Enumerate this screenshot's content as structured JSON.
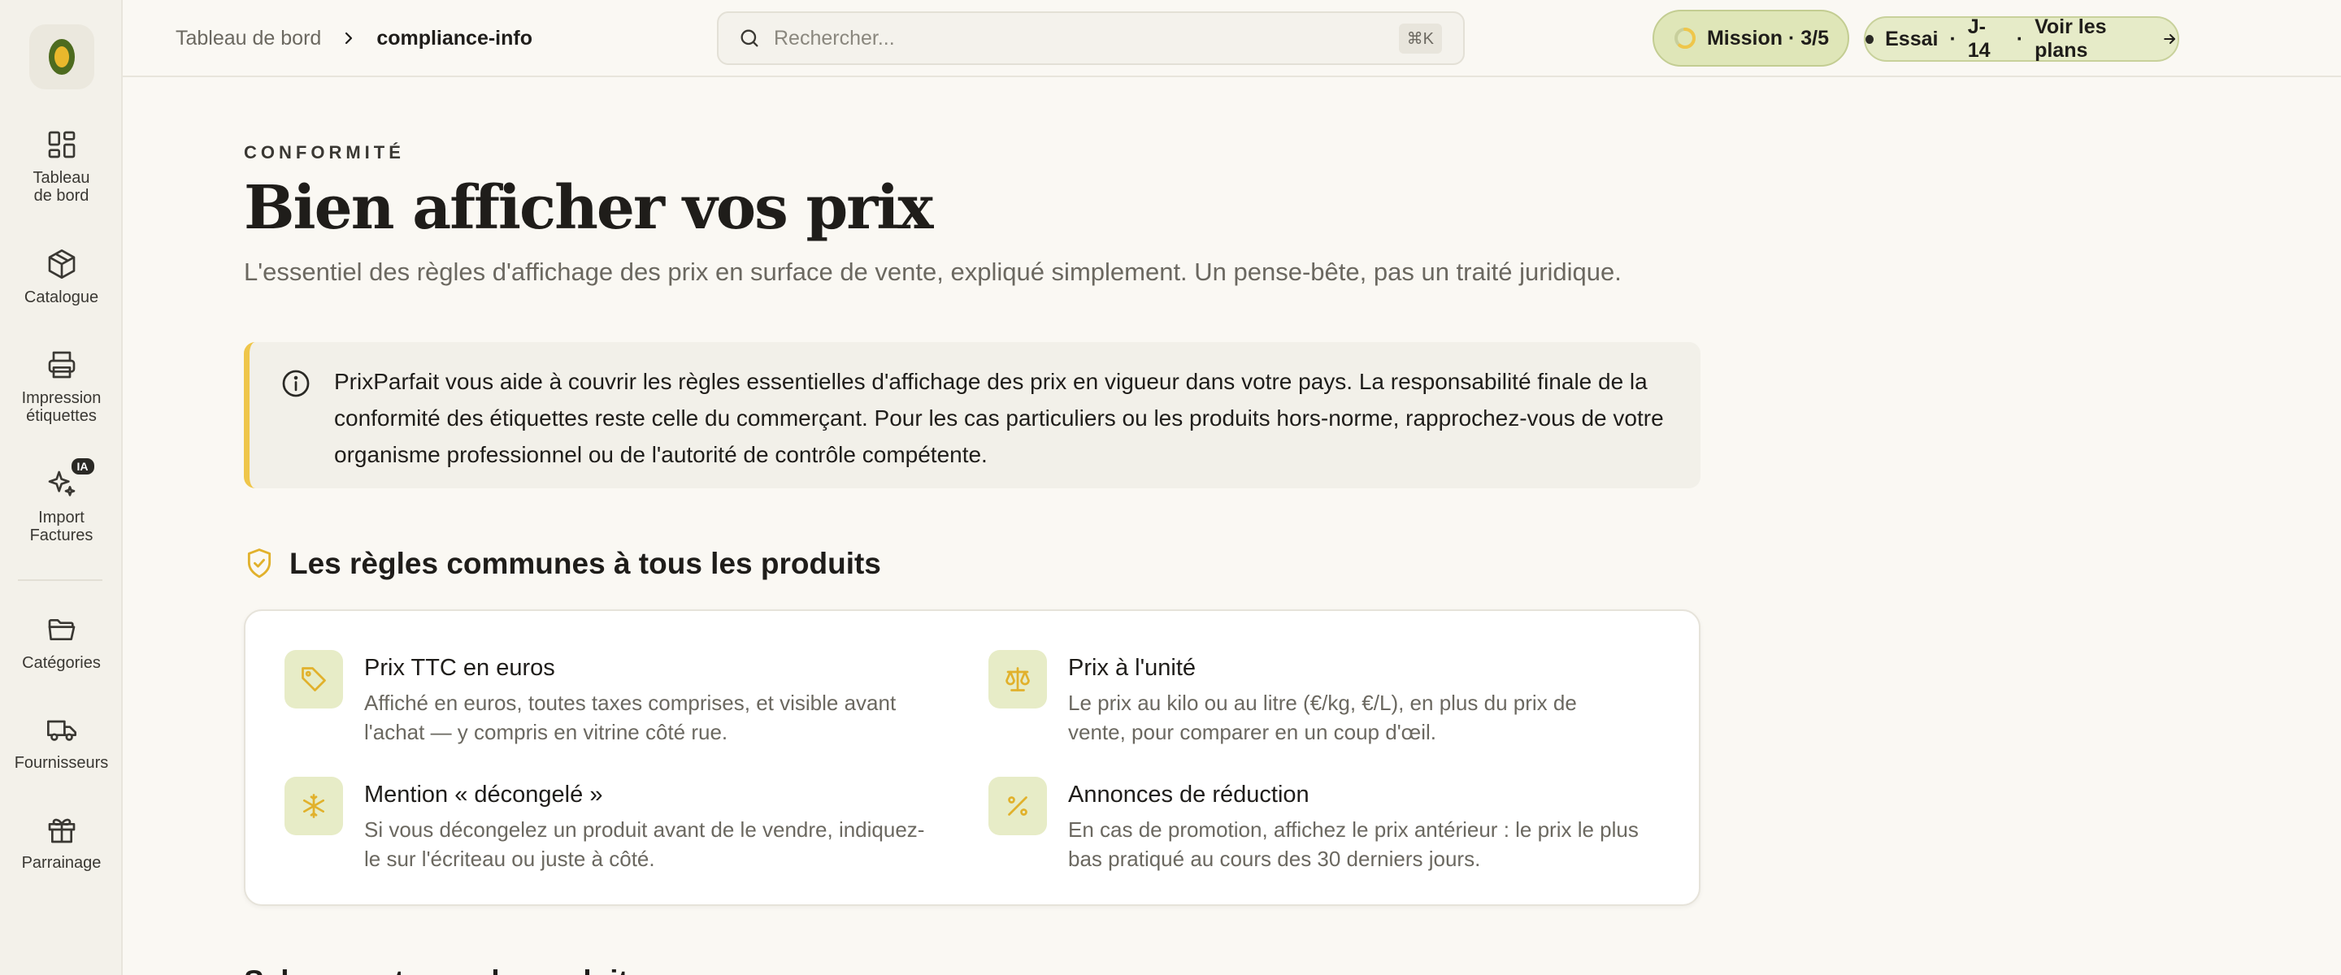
{
  "sidebar": {
    "items": [
      {
        "label": "Tableau\nde bord",
        "icon": "dashboard-icon"
      },
      {
        "label": "Catalogue",
        "icon": "package-icon"
      },
      {
        "label": "Impression\nétiquettes",
        "icon": "printer-icon"
      },
      {
        "label": "Import\nFactures",
        "icon": "sparkles-icon",
        "badge": "IA"
      },
      {
        "label": "Catégories",
        "icon": "folder-icon"
      },
      {
        "label": "Fournisseurs",
        "icon": "truck-icon"
      },
      {
        "label": "Parrainage",
        "icon": "gift-icon"
      }
    ]
  },
  "topbar": {
    "breadcrumb": {
      "root": "Tableau de bord",
      "current": "compliance-info"
    },
    "search": {
      "placeholder": "Rechercher...",
      "shortcut": "⌘K"
    },
    "mission": {
      "label": "Mission · 3/5",
      "progress": 0.6
    },
    "trial": {
      "label": "Essai",
      "days": "J-14",
      "cta": "Voir les plans"
    }
  },
  "page": {
    "eyebrow": "CONFORMITÉ",
    "title": "Bien afficher vos prix",
    "subtitle": "L'essentiel des règles d'affichage des prix en surface de vente, expliqué simplement. Un pense-bête, pas un traité juridique.",
    "notice": "PrixParfait vous aide à couvrir les règles essentielles d'affichage des prix en vigueur dans votre pays. La responsabilité finale de la conformité des étiquettes reste celle du commerçant. Pour les cas particuliers ou les produits hors-norme, rapprochez-vous de votre organisme professionnel ou de l'autorité de contrôle compétente.",
    "section_title": "Les règles communes à tous les produits",
    "rules": [
      {
        "title": "Prix TTC en euros",
        "desc": "Affiché en euros, toutes taxes comprises, et visible avant l'achat — y compris en vitrine côté rue.",
        "icon": "tag-icon"
      },
      {
        "title": "Prix à l'unité",
        "desc": "Le prix au kilo ou au litre (€/kg, €/L), en plus du prix de vente, pour comparer en un coup d'œil.",
        "icon": "scale-icon"
      },
      {
        "title": "Mention « décongelé »",
        "desc": "Si vous décongelez un produit avant de le vendre, indiquez-le sur l'écriteau ou juste à côté.",
        "icon": "snowflake-icon"
      },
      {
        "title": "Annonces de réduction",
        "desc": "En cas de promotion, affichez le prix antérieur : le prix le plus bas pratiqué au cours des 30 derniers jours.",
        "icon": "percent-icon"
      }
    ],
    "next_section_title": "Selon vos types de produits"
  },
  "colors": {
    "accent_yellow": "#efc64a",
    "pill_green": "#dfe6b8",
    "icon_tile": "#e7ecc7",
    "background": "#faf8f3",
    "sidebar": "#f3f1ea"
  }
}
